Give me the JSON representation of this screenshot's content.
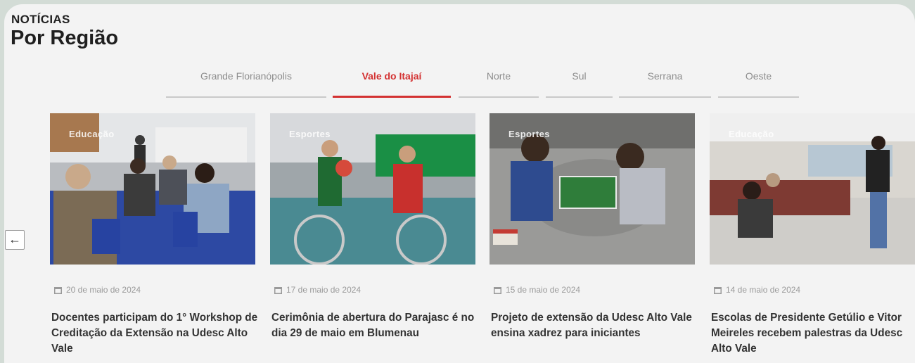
{
  "section": {
    "eyebrow": "NOTÍCIAS",
    "title": "Por Região"
  },
  "tabs": [
    {
      "label": "Grande Florianópolis",
      "active": false
    },
    {
      "label": "Vale do Itajaí",
      "active": true
    },
    {
      "label": "Norte",
      "active": false
    },
    {
      "label": "Sul",
      "active": false
    },
    {
      "label": "Serrana",
      "active": false
    },
    {
      "label": "Oeste",
      "active": false
    }
  ],
  "carousel": {
    "prev_icon": "arrow-left-icon"
  },
  "cards": [
    {
      "category": "Educação",
      "date": "20 de maio de 2024",
      "title": "Docentes participam do 1° Workshop de Creditação da Extensão na Udesc Alto Vale"
    },
    {
      "category": "Esportes",
      "date": "17 de maio de 2024",
      "title": "Cerimônia de abertura do Parajasc é no dia 29 de maio em Blumenau"
    },
    {
      "category": "Esportes",
      "date": "15 de maio de 2024",
      "title": "Projeto de extensão da Udesc Alto Vale ensina xadrez para iniciantes"
    },
    {
      "category": "Educação",
      "date": "14 de maio de 2024",
      "title": "Escolas de Presidente Getúlio e Vitor Meireles recebem palestras da Udesc Alto Vale"
    }
  ],
  "colors": {
    "accent": "#d33131",
    "muted_text": "#8e8e8e",
    "background": "#f3f3f3"
  }
}
